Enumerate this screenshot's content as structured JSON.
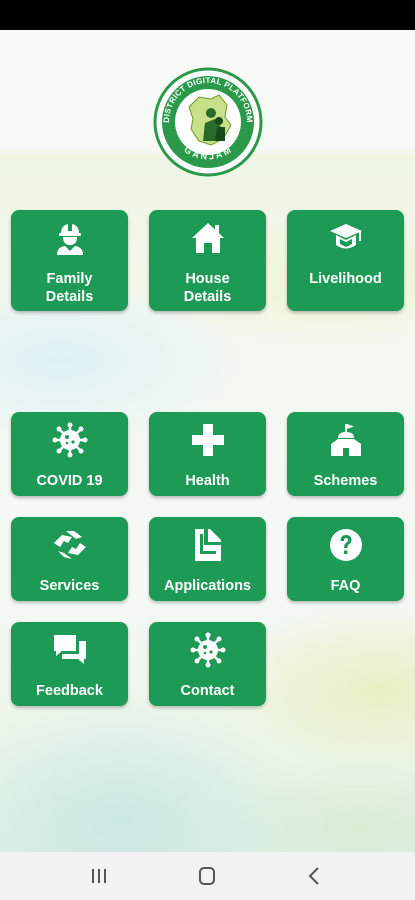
{
  "app": {
    "logo_text_top": "DISTRICT DIGITAL PLATFORM",
    "logo_text_bottom": "GANJAM"
  },
  "tiles": [
    {
      "label_line1": "Family",
      "label_line2": "Details",
      "icon": "worker-icon"
    },
    {
      "label_line1": "House",
      "label_line2": "Details",
      "icon": "house-icon"
    },
    {
      "label": "Livelihood",
      "icon": "graduation-cap-icon"
    },
    {
      "label": "COVID 19",
      "icon": "virus-icon"
    },
    {
      "label": "Health",
      "icon": "plus-cross-icon"
    },
    {
      "label": "Schemes",
      "icon": "building-flag-icon"
    },
    {
      "label": "Services",
      "icon": "handshake-icon"
    },
    {
      "label": "Applications",
      "icon": "document-icon"
    },
    {
      "label": "FAQ",
      "icon": "question-circle-icon"
    },
    {
      "label": "Feedback",
      "icon": "chat-bubbles-icon"
    },
    {
      "label": "Contact",
      "icon": "virus-icon"
    }
  ],
  "colors": {
    "tile": "#1d9a55",
    "logo_ring": "#2a9a4a"
  },
  "navigation": {
    "recent": "recent-apps-icon",
    "home": "home-icon",
    "back": "back-icon"
  }
}
